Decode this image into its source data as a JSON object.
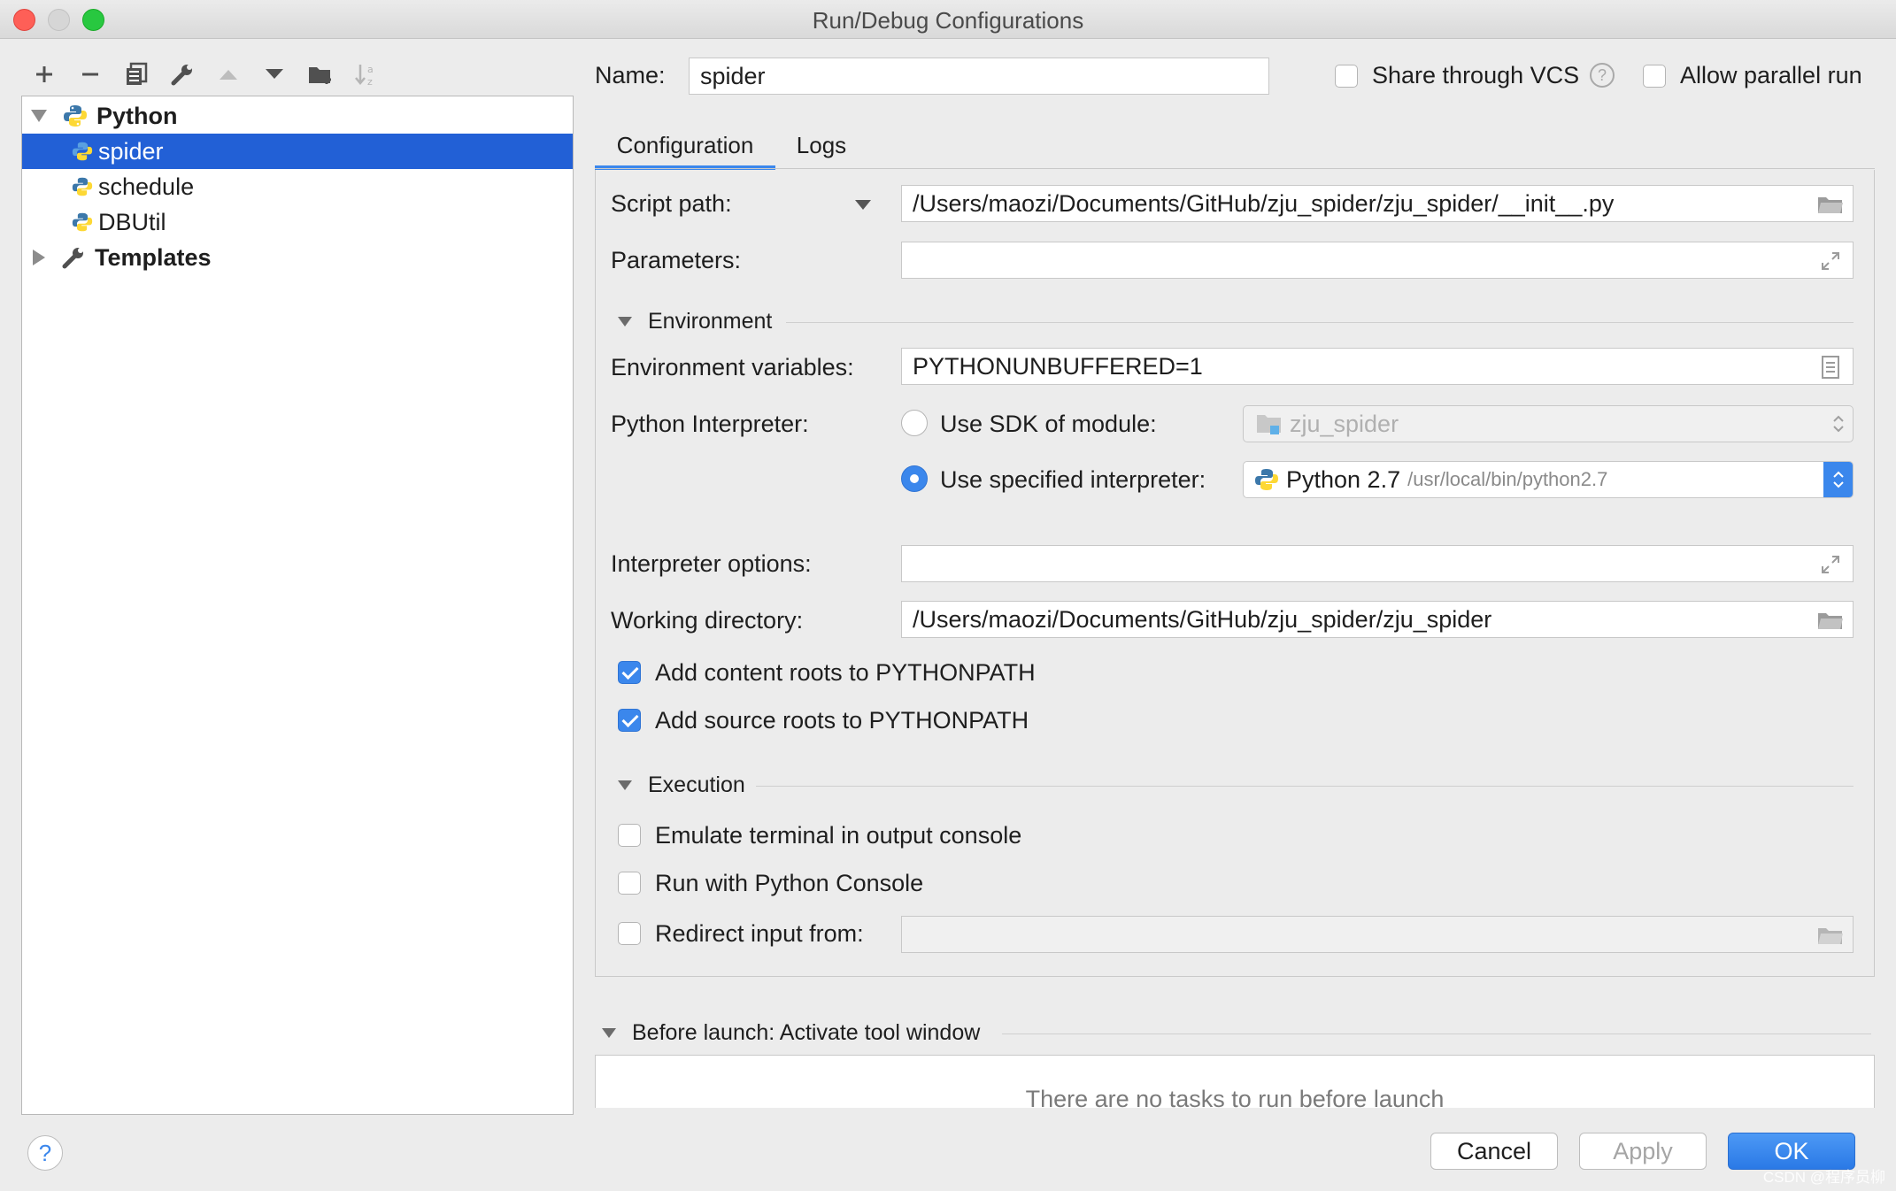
{
  "window": {
    "title": "Run/Debug Configurations"
  },
  "toolbar": {
    "icons": [
      "add-icon",
      "remove-icon",
      "copy-icon",
      "wrench-icon",
      "move-up-icon",
      "move-down-icon",
      "new-folder-icon",
      "sort-icon"
    ]
  },
  "tree": {
    "python_group": "Python",
    "items": [
      {
        "label": "spider",
        "selected": true
      },
      {
        "label": "schedule",
        "selected": false
      },
      {
        "label": "DBUtil",
        "selected": false
      }
    ],
    "templates": "Templates"
  },
  "header": {
    "name_label": "Name:",
    "name_value": "spider",
    "share_vcs": "Share through VCS",
    "share_vcs_checked": false,
    "allow_parallel": "Allow parallel run",
    "allow_parallel_checked": false
  },
  "tabs": [
    {
      "label": "Configuration",
      "active": true
    },
    {
      "label": "Logs",
      "active": false
    }
  ],
  "config": {
    "script_path_label": "Script path:",
    "script_path_value": "/Users/maozi/Documents/GitHub/zju_spider/zju_spider/__init__.py",
    "parameters_label": "Parameters:",
    "parameters_value": "",
    "environment_section": "Environment",
    "env_vars_label": "Environment variables:",
    "env_vars_value": "PYTHONUNBUFFERED=1",
    "interpreter_label": "Python Interpreter:",
    "use_sdk_label": "Use SDK of module:",
    "use_sdk_checked": false,
    "sdk_module": "zju_spider",
    "use_specified_label": "Use specified interpreter:",
    "use_specified_checked": true,
    "interpreter_name": "Python 2.7",
    "interpreter_path": "/usr/local/bin/python2.7",
    "interp_options_label": "Interpreter options:",
    "interp_options_value": "",
    "working_dir_label": "Working directory:",
    "working_dir_value": "/Users/maozi/Documents/GitHub/zju_spider/zju_spider",
    "add_content_roots": "Add content roots to PYTHONPATH",
    "add_content_roots_checked": true,
    "add_source_roots": "Add source roots to PYTHONPATH",
    "add_source_roots_checked": true,
    "execution_section": "Execution",
    "emulate_terminal": "Emulate terminal in output console",
    "emulate_terminal_checked": false,
    "run_with_console": "Run with Python Console",
    "run_with_console_checked": false,
    "redirect_input": "Redirect input from:",
    "redirect_input_checked": false,
    "redirect_input_value": ""
  },
  "before_launch": {
    "title": "Before launch: Activate tool window",
    "empty_text": "There are no tasks to run before launch"
  },
  "buttons": {
    "help": "?",
    "cancel": "Cancel",
    "apply": "Apply",
    "ok": "OK"
  },
  "watermark": "CSDN @程序员柳",
  "colors": {
    "accent": "#3b87ec",
    "selection": "#2260d6",
    "close": "#fe5f57",
    "zoom": "#28c840"
  }
}
